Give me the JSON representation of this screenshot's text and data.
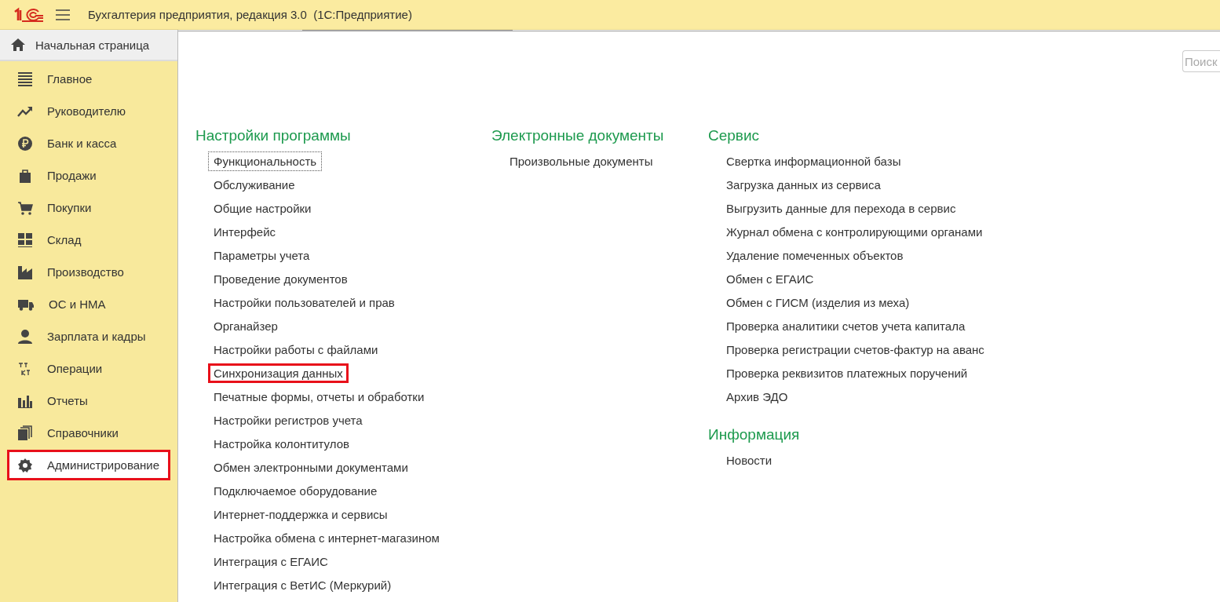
{
  "window": {
    "title": "Бухгалтерия предприятия, редакция 3.0  (1С:Предприятие)"
  },
  "home_tab": {
    "label": "Начальная страница"
  },
  "sidebar": {
    "items": [
      {
        "label": "Главное",
        "selected": false,
        "highlighted": false
      },
      {
        "label": "Руководителю",
        "selected": false,
        "highlighted": false
      },
      {
        "label": "Банк и касса",
        "selected": false,
        "highlighted": false
      },
      {
        "label": "Продажи",
        "selected": false,
        "highlighted": false
      },
      {
        "label": "Покупки",
        "selected": false,
        "highlighted": false
      },
      {
        "label": "Склад",
        "selected": false,
        "highlighted": false
      },
      {
        "label": "Производство",
        "selected": false,
        "highlighted": false
      },
      {
        "label": "ОС и НМА",
        "selected": false,
        "highlighted": false
      },
      {
        "label": "Зарплата и кадры",
        "selected": false,
        "highlighted": false
      },
      {
        "label": "Операции",
        "selected": false,
        "highlighted": false
      },
      {
        "label": "Отчеты",
        "selected": false,
        "highlighted": false
      },
      {
        "label": "Справочники",
        "selected": false,
        "highlighted": false
      },
      {
        "label": "Администрирование",
        "selected": true,
        "highlighted": true
      }
    ]
  },
  "search": {
    "placeholder": "Поиск"
  },
  "columns": [
    {
      "sections": [
        {
          "title": "Настройки программы",
          "links": [
            {
              "label": "Функциональность",
              "focused": true,
              "highlighted": false
            },
            {
              "label": "Обслуживание",
              "focused": false,
              "highlighted": false
            },
            {
              "label": "Общие настройки",
              "focused": false,
              "highlighted": false
            },
            {
              "label": "Интерфейс",
              "focused": false,
              "highlighted": false
            },
            {
              "label": "Параметры учета",
              "focused": false,
              "highlighted": false
            },
            {
              "label": "Проведение документов",
              "focused": false,
              "highlighted": false
            },
            {
              "label": "Настройки пользователей и прав",
              "focused": false,
              "highlighted": false
            },
            {
              "label": "Органайзер",
              "focused": false,
              "highlighted": false
            },
            {
              "label": "Настройки работы с файлами",
              "focused": false,
              "highlighted": false
            },
            {
              "label": "Синхронизация данных",
              "focused": false,
              "highlighted": true
            },
            {
              "label": "Печатные формы, отчеты и обработки",
              "focused": false,
              "highlighted": false
            },
            {
              "label": "Настройки регистров учета",
              "focused": false,
              "highlighted": false
            },
            {
              "label": "Настройка колонтитулов",
              "focused": false,
              "highlighted": false
            },
            {
              "label": "Обмен электронными документами",
              "focused": false,
              "highlighted": false
            },
            {
              "label": "Подключаемое оборудование",
              "focused": false,
              "highlighted": false
            },
            {
              "label": "Интернет-поддержка и сервисы",
              "focused": false,
              "highlighted": false
            },
            {
              "label": "Настройка обмена с интернет-магазином",
              "focused": false,
              "highlighted": false
            },
            {
              "label": "Интеграция с ЕГАИС",
              "focused": false,
              "highlighted": false
            },
            {
              "label": "Интеграция с ВетИС (Меркурий)",
              "focused": false,
              "highlighted": false
            }
          ]
        }
      ]
    },
    {
      "sections": [
        {
          "title": "Электронные документы",
          "links": [
            {
              "label": "Произвольные документы",
              "focused": false,
              "highlighted": false
            }
          ]
        }
      ]
    },
    {
      "sections": [
        {
          "title": "Сервис",
          "links": [
            {
              "label": "Свертка информационной базы",
              "focused": false,
              "highlighted": false
            },
            {
              "label": "Загрузка данных из сервиса",
              "focused": false,
              "highlighted": false
            },
            {
              "label": "Выгрузить данные для перехода в сервис",
              "focused": false,
              "highlighted": false
            },
            {
              "label": "Журнал обмена с контролирующими органами",
              "focused": false,
              "highlighted": false
            },
            {
              "label": "Удаление помеченных объектов",
              "focused": false,
              "highlighted": false
            },
            {
              "label": "Обмен с ЕГАИС",
              "focused": false,
              "highlighted": false
            },
            {
              "label": "Обмен с ГИСМ (изделия из меха)",
              "focused": false,
              "highlighted": false
            },
            {
              "label": "Проверка аналитики счетов учета капитала",
              "focused": false,
              "highlighted": false
            },
            {
              "label": "Проверка регистрации счетов-фактур на аванс",
              "focused": false,
              "highlighted": false
            },
            {
              "label": "Проверка реквизитов платежных поручений",
              "focused": false,
              "highlighted": false
            },
            {
              "label": "Архив ЭДО",
              "focused": false,
              "highlighted": false
            }
          ]
        },
        {
          "title": "Информация",
          "links": [
            {
              "label": "Новости",
              "focused": false,
              "highlighted": false
            }
          ]
        }
      ]
    }
  ]
}
